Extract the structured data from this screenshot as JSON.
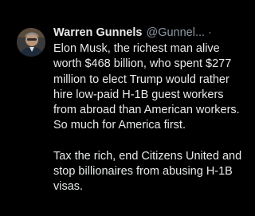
{
  "tweet": {
    "author_name": "Warren Gunnels",
    "handle": "@Gunnel...",
    "separator": "·",
    "paragraphs": [
      "Elon Musk, the richest man alive\nworth $468 billion, who spent $277\nmillion to elect Trump would rather\nhire low-paid H-1B guest workers\nfrom abroad than American workers.\nSo much for America first.",
      "Tax the rich, end Citizens United and\nstop billionaires from abusing H-1B\nvisas."
    ]
  },
  "colors": {
    "background": "#000000",
    "text": "#e7e9ea",
    "muted": "#8b98a5"
  }
}
